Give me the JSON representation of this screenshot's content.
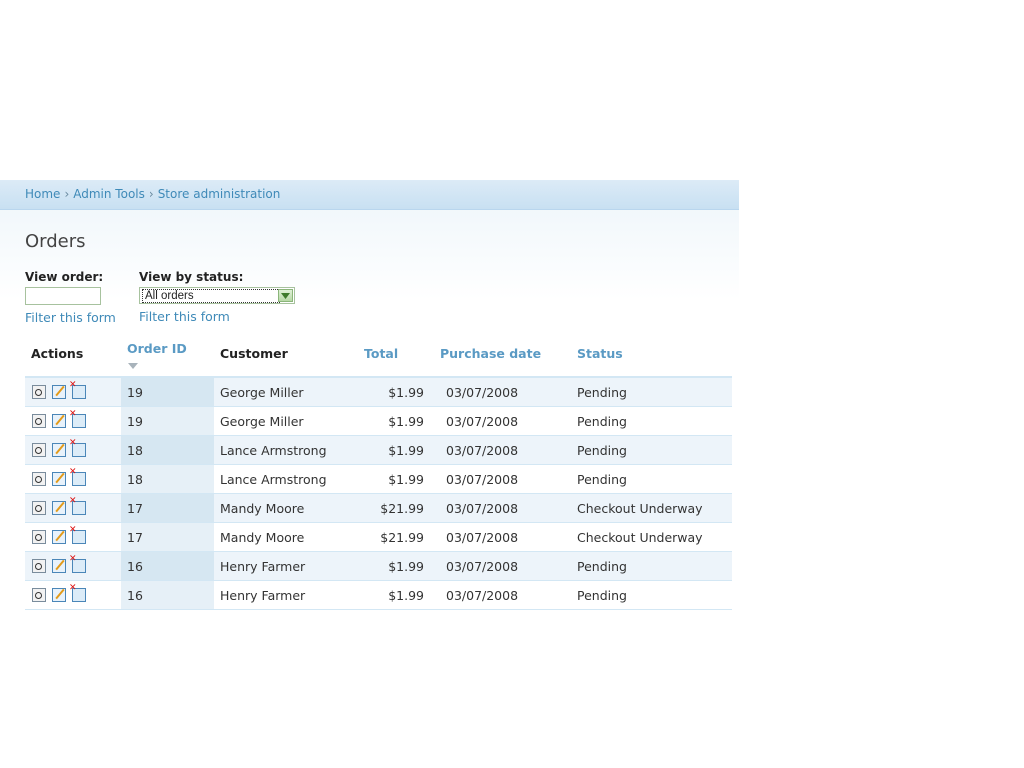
{
  "breadcrumb": {
    "items": [
      "Home",
      "Admin Tools",
      "Store administration"
    ],
    "separator": "›"
  },
  "page_title": "Orders",
  "filters": {
    "view_order_label": "View order:",
    "view_order_value": "",
    "view_status_label": "View by status:",
    "view_status_selected": "All orders",
    "filter_link": "Filter this form"
  },
  "table": {
    "columns": [
      "Actions",
      "Order ID",
      "Customer",
      "Total",
      "Purchase date",
      "Status"
    ],
    "sort_column": "Order ID",
    "rows": [
      {
        "order_id": "19",
        "customer": "George Miller",
        "total": "$1.99",
        "date": "03/07/2008",
        "status": "Pending"
      },
      {
        "order_id": "19",
        "customer": "George Miller",
        "total": "$1.99",
        "date": "03/07/2008",
        "status": "Pending"
      },
      {
        "order_id": "18",
        "customer": "Lance Armstrong",
        "total": "$1.99",
        "date": "03/07/2008",
        "status": "Pending"
      },
      {
        "order_id": "18",
        "customer": "Lance Armstrong",
        "total": "$1.99",
        "date": "03/07/2008",
        "status": "Pending"
      },
      {
        "order_id": "17",
        "customer": "Mandy Moore",
        "total": "$21.99",
        "date": "03/07/2008",
        "status": "Checkout Underway"
      },
      {
        "order_id": "17",
        "customer": "Mandy Moore",
        "total": "$21.99",
        "date": "03/07/2008",
        "status": "Checkout Underway"
      },
      {
        "order_id": "16",
        "customer": "Henry Farmer",
        "total": "$1.99",
        "date": "03/07/2008",
        "status": "Pending"
      },
      {
        "order_id": "16",
        "customer": "Henry Farmer",
        "total": "$1.99",
        "date": "03/07/2008",
        "status": "Pending"
      }
    ],
    "action_icons": [
      "view-icon",
      "edit-icon",
      "delete-icon"
    ]
  },
  "colors": {
    "link": "#3f8ab8",
    "header_sortable": "#5a9ac4",
    "row_odd": "#edf4fa"
  }
}
